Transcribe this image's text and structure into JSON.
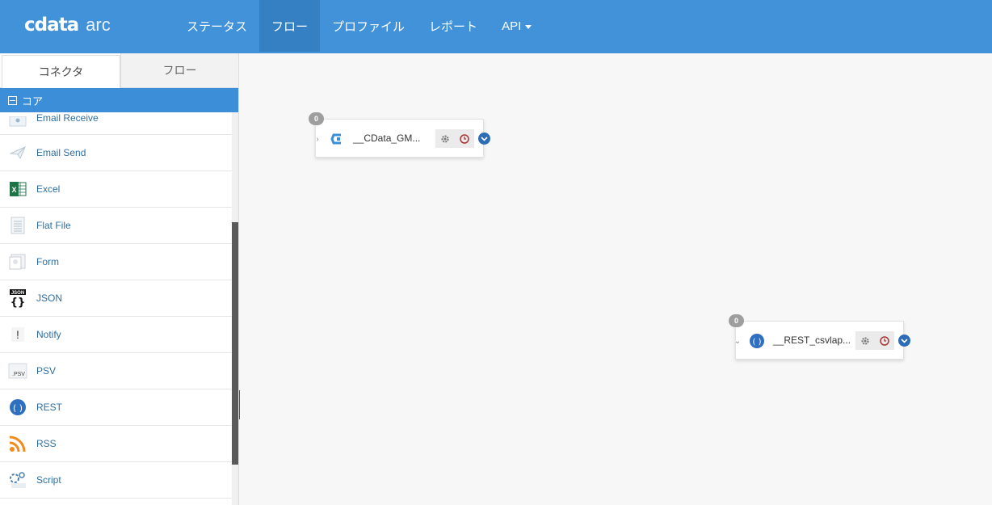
{
  "app": {
    "brand": "cdata",
    "product": "arc"
  },
  "nav": {
    "items": [
      {
        "label": "ステータス"
      },
      {
        "label": "フロー"
      },
      {
        "label": "プロファイル"
      },
      {
        "label": "レポート"
      },
      {
        "label": "API"
      }
    ],
    "active": "フロー"
  },
  "sidebar": {
    "tabs": [
      {
        "label": "コネクタ"
      },
      {
        "label": "フロー"
      }
    ],
    "active_tab": "コネクタ",
    "section": "コア",
    "items": [
      {
        "label": "Email Receive",
        "icon": "email-receive-icon"
      },
      {
        "label": "Email Send",
        "icon": "paper-plane-icon"
      },
      {
        "label": "Excel",
        "icon": "excel-icon"
      },
      {
        "label": "Flat File",
        "icon": "flat-file-icon"
      },
      {
        "label": "Form",
        "icon": "form-icon"
      },
      {
        "label": "JSON",
        "icon": "json-icon"
      },
      {
        "label": "Notify",
        "icon": "notify-icon"
      },
      {
        "label": "PSV",
        "icon": "psv-icon"
      },
      {
        "label": "REST",
        "icon": "rest-icon"
      },
      {
        "label": "RSS",
        "icon": "rss-icon"
      },
      {
        "label": "Script",
        "icon": "script-icon"
      }
    ]
  },
  "canvas": {
    "nodes": [
      {
        "name": "__CData_GM...",
        "badge": "0",
        "icon": "cdata-icon"
      },
      {
        "name": "__REST_csvlap...",
        "badge": "0",
        "icon": "rest-icon"
      }
    ]
  },
  "colors": {
    "header": "#4192d9",
    "active_nav": "#3480c2",
    "section": "#3d8ed8",
    "port": "#2d6db5"
  }
}
